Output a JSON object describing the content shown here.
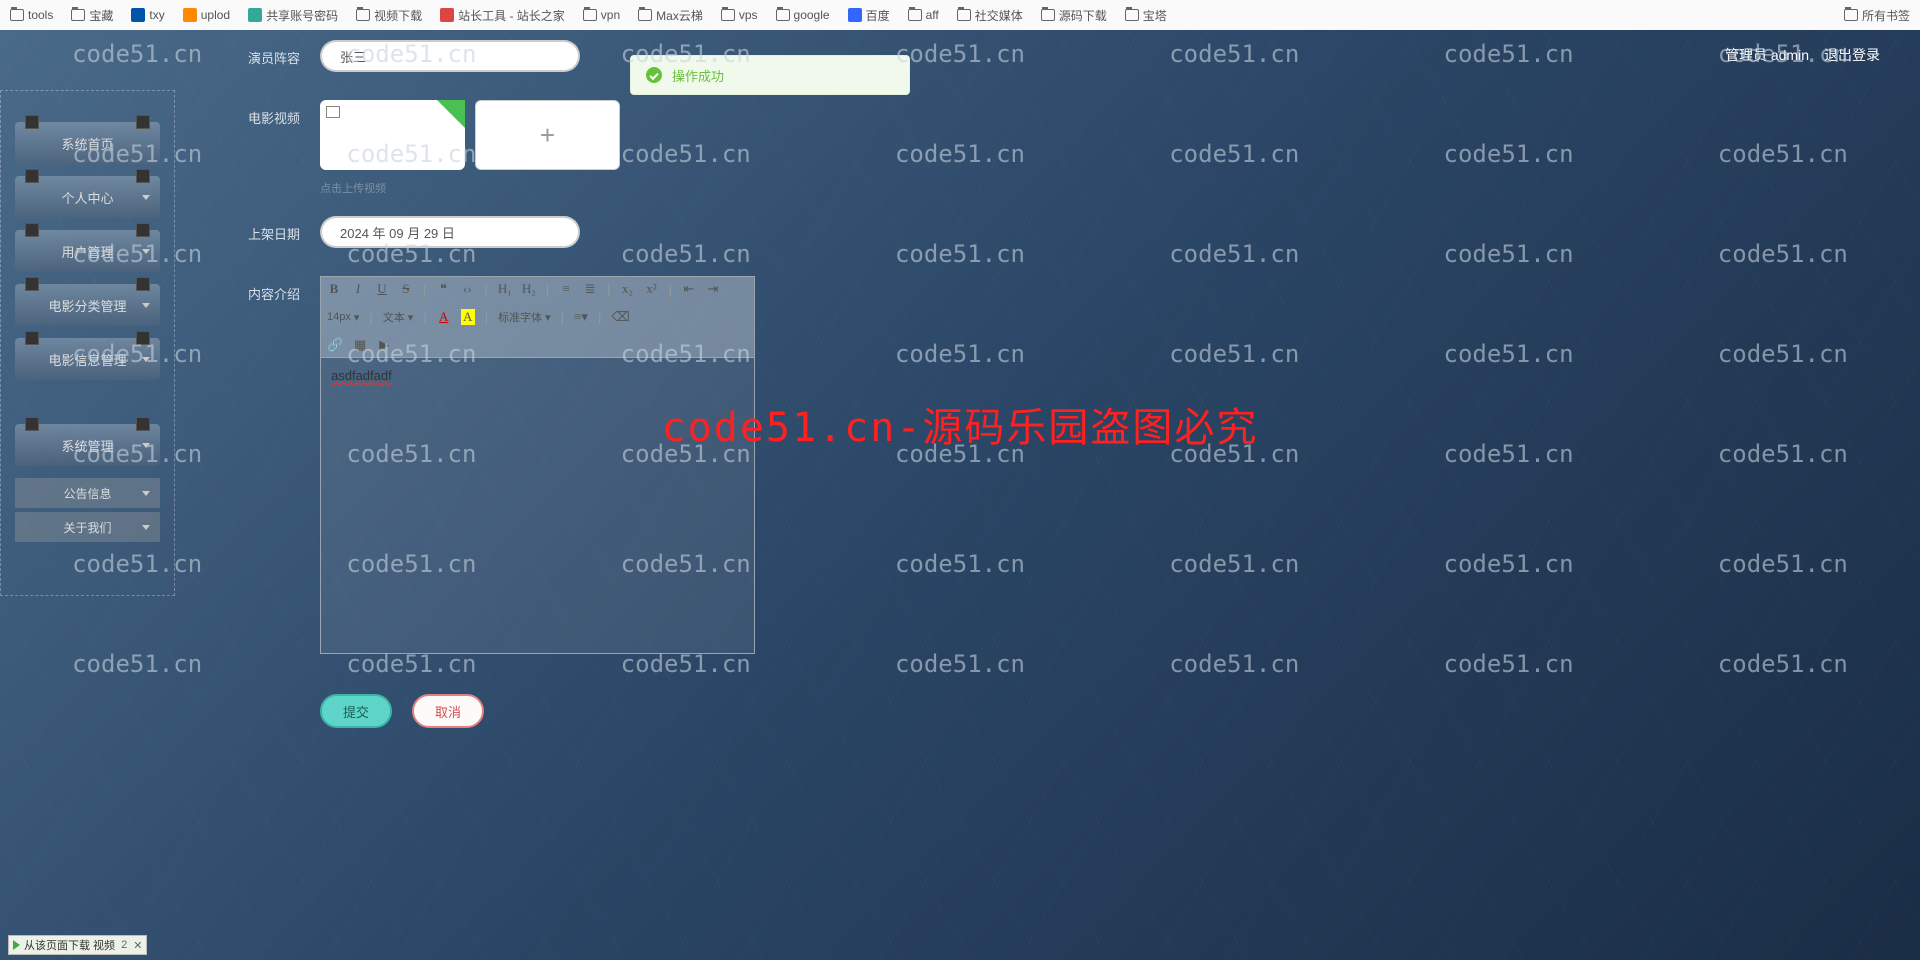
{
  "bookmarks_left": [
    {
      "label": "tools",
      "type": "folder"
    },
    {
      "label": "宝藏",
      "type": "folder"
    },
    {
      "label": "txy",
      "type": "icon-blue"
    },
    {
      "label": "uplod",
      "type": "icon-orange"
    },
    {
      "label": "共享账号密码",
      "type": "icon-green"
    },
    {
      "label": "视频下载",
      "type": "folder"
    },
    {
      "label": "站长工具 - 站长之家",
      "type": "icon-red"
    },
    {
      "label": "vpn",
      "type": "folder"
    },
    {
      "label": "Max云梯",
      "type": "folder"
    },
    {
      "label": "vps",
      "type": "folder"
    },
    {
      "label": "google",
      "type": "folder"
    },
    {
      "label": "百度",
      "type": "icon-paw"
    },
    {
      "label": "aff",
      "type": "folder"
    },
    {
      "label": "社交媒体",
      "type": "folder"
    },
    {
      "label": "源码下载",
      "type": "folder"
    },
    {
      "label": "宝塔",
      "type": "folder"
    }
  ],
  "bookmarks_right": [
    {
      "label": "所有书签",
      "type": "folder"
    }
  ],
  "topbar": {
    "admin_label": "管理员 admin",
    "logout_label": "退出登录"
  },
  "toast": {
    "text": "操作成功"
  },
  "sidebar": {
    "items": [
      {
        "label": "系统首页",
        "expandable": false
      },
      {
        "label": "个人中心",
        "expandable": true
      },
      {
        "label": "用户管理",
        "expandable": true
      },
      {
        "label": "电影分类管理",
        "expandable": true
      },
      {
        "label": "电影信息管理",
        "expandable": true
      }
    ],
    "sysmgmt": {
      "label": "系统管理",
      "expandable": true
    },
    "subitems": [
      {
        "label": "公告信息"
      },
      {
        "label": "关于我们"
      }
    ]
  },
  "form": {
    "cast_label": "演员阵容",
    "cast_value": "张三",
    "video_label": "电影视频",
    "hint": "点击上传视频",
    "date_label": "上架日期",
    "date_value": "2024 年 09 月 29 日",
    "intro_label": "内容介绍",
    "editor_content": "asdfadfadf",
    "font_size": "14px",
    "font_style": "文本",
    "font_family": "标准字体",
    "submit": "提交",
    "cancel": "取消"
  },
  "download_bar": {
    "text": "从该页面下载 视频",
    "count": "2"
  },
  "watermark": {
    "small": "code51.cn",
    "big": "code51.cn-源码乐园盗图必究"
  }
}
